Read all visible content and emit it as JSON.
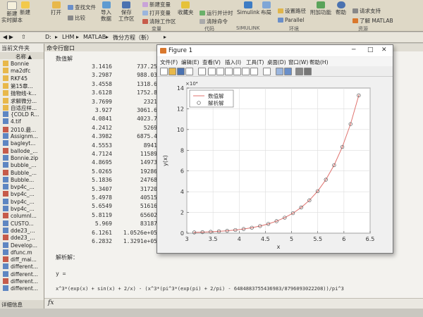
{
  "toolstrip": {
    "buttons": [
      "新建\n实时脚本",
      "新建",
      "打开",
      "查找文件",
      "比较",
      "导入\n数据",
      "保存\n工作区",
      "新建变量",
      "打开变量",
      "清除工作区",
      "收藏夹",
      "运行并计时",
      "清除命令",
      "Simulink",
      "布局",
      "设置路径",
      "附加功能",
      "帮助",
      "请求支持",
      "了解 MATLAB",
      "Parallel"
    ],
    "groups": [
      "变量",
      "代码",
      "SIMULINK",
      "环境",
      "资源"
    ]
  },
  "path": {
    "parts": [
      "D:",
      "LHM",
      "MATLAB",
      "微分方程（靳）"
    ]
  },
  "file_panel": {
    "title": "当前文件夹",
    "header": "名称 ▲",
    "files": [
      "Bonnie",
      "ma2dfc",
      "RKF45",
      "第15章...",
      "抛物线-k...",
      "求解微分...",
      "自适应样...",
      "{COLD R...",
      "4.tif",
      "2010.最...",
      "Assignm...",
      "bagleyt...",
      "ballode_...",
      "Bonnie.zip",
      "bubble_...",
      "Bubble_...",
      "Bubble...",
      "bvp4c_...",
      "bvp4c_...",
      "bvp4c_...",
      "bvp4c_...",
      "columnl...",
      "CUSTO...",
      "dde23_...",
      "dde23_...",
      "Develop...",
      "dfunc.m",
      "diff_mai...",
      "different...",
      "different...",
      "different...",
      "different..."
    ],
    "bottom": "详细信息"
  },
  "command_window": {
    "title": "命令行窗口",
    "header": "数值解",
    "rows": [
      [
        "3.1416",
        "737.25"
      ],
      [
        "3.2987",
        "988.03"
      ],
      [
        "3.4558",
        "1318.6"
      ],
      [
        "3.6128",
        "1752.8"
      ],
      [
        "3.7699",
        "2321"
      ],
      [
        "3.927",
        "3061.6"
      ],
      [
        "4.0841",
        "4023.7"
      ],
      [
        "4.2412",
        "5269"
      ],
      [
        "4.3982",
        "6875.4"
      ],
      [
        "4.5553",
        "8941"
      ],
      [
        "4.7124",
        "11589"
      ],
      [
        "4.8695",
        "14973"
      ],
      [
        "5.0265",
        "19286"
      ],
      [
        "5.1836",
        "24768"
      ],
      [
        "5.3407",
        "31720"
      ],
      [
        "5.4978",
        "40515"
      ],
      [
        "5.6549",
        "51616"
      ],
      [
        "5.8119",
        "65602"
      ],
      [
        "5.969",
        "83187"
      ],
      [
        "6.1261",
        "1.0526e+05"
      ],
      [
        "6.2832",
        "1.3291e+05"
      ]
    ],
    "analytic_label": "解析解：",
    "y_eq": "y =",
    "expression": "x^3*(exp(x) + sin(x) + 2/x) - (x^3*(pi^3*(exp(pi) + 2/pi) - 6484883755436983/8796093022208))/pi^3",
    "prompt_symbol": "fx"
  },
  "figure": {
    "title": "Figure 1",
    "menu": [
      "文件(F)",
      "编辑(E)",
      "查看(V)",
      "插入(I)",
      "工具(T)",
      "桌面(D)",
      "窗口(W)",
      "帮助(H)"
    ]
  },
  "chart_data": {
    "type": "line",
    "xlabel": "x",
    "ylabel": "y(x)",
    "exponent_label": "×10⁴",
    "xlim": [
      3,
      6.5
    ],
    "ylim": [
      0,
      14
    ],
    "xticks": [
      "3",
      "3.5",
      "4",
      "4.5",
      "5",
      "5.5",
      "6",
      "6.5"
    ],
    "yticks": [
      "0",
      "2",
      "4",
      "6",
      "8",
      "10",
      "12",
      "14"
    ],
    "grid": true,
    "legend_position": "top-left",
    "series": [
      {
        "name": "数值解",
        "style": "line",
        "color": "#e0736f",
        "x": [
          3.1416,
          3.2987,
          3.4558,
          3.6128,
          3.7699,
          3.927,
          4.0841,
          4.2412,
          4.3982,
          4.5553,
          4.7124,
          4.8695,
          5.0265,
          5.1836,
          5.3407,
          5.4978,
          5.6549,
          5.8119,
          5.969,
          6.1261,
          6.2832
        ],
        "y": [
          0.0737,
          0.0988,
          0.1319,
          0.1753,
          0.2321,
          0.3062,
          0.4024,
          0.5269,
          0.6875,
          0.8941,
          1.1589,
          1.4973,
          1.9286,
          2.4768,
          3.172,
          4.0515,
          5.1616,
          6.5602,
          8.3187,
          10.526,
          13.291
        ]
      },
      {
        "name": "解析解",
        "style": "marker",
        "color": "#555555",
        "x": [
          3.1416,
          3.2987,
          3.4558,
          3.6128,
          3.7699,
          3.927,
          4.0841,
          4.2412,
          4.3982,
          4.5553,
          4.7124,
          4.8695,
          5.0265,
          5.1836,
          5.3407,
          5.4978,
          5.6549,
          5.8119,
          5.969,
          6.1261,
          6.2832
        ],
        "y": [
          0.0737,
          0.0988,
          0.1319,
          0.1753,
          0.2321,
          0.3062,
          0.4024,
          0.5269,
          0.6875,
          0.8941,
          1.1589,
          1.4973,
          1.9286,
          2.4768,
          3.172,
          4.0515,
          5.1616,
          6.5602,
          8.3187,
          10.526,
          13.291
        ]
      }
    ]
  }
}
